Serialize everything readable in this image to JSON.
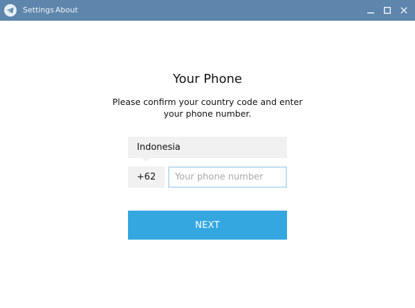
{
  "titlebar": {
    "menu": [
      {
        "label": "Settings"
      },
      {
        "label": "About"
      }
    ],
    "icons": {
      "logo": "telegram-plane-icon",
      "minimize": "minimize-icon",
      "maximize": "maximize-icon",
      "close": "close-icon"
    },
    "background_color": "#5e86ac"
  },
  "main": {
    "title": "Your Phone",
    "description": "Please confirm your country code and enter your phone number.",
    "country": "Indonesia",
    "country_code": "+62",
    "phone": {
      "value": "",
      "placeholder": "Your phone number"
    },
    "next_label": "NEXT",
    "accent_color": "#35a7e0"
  }
}
